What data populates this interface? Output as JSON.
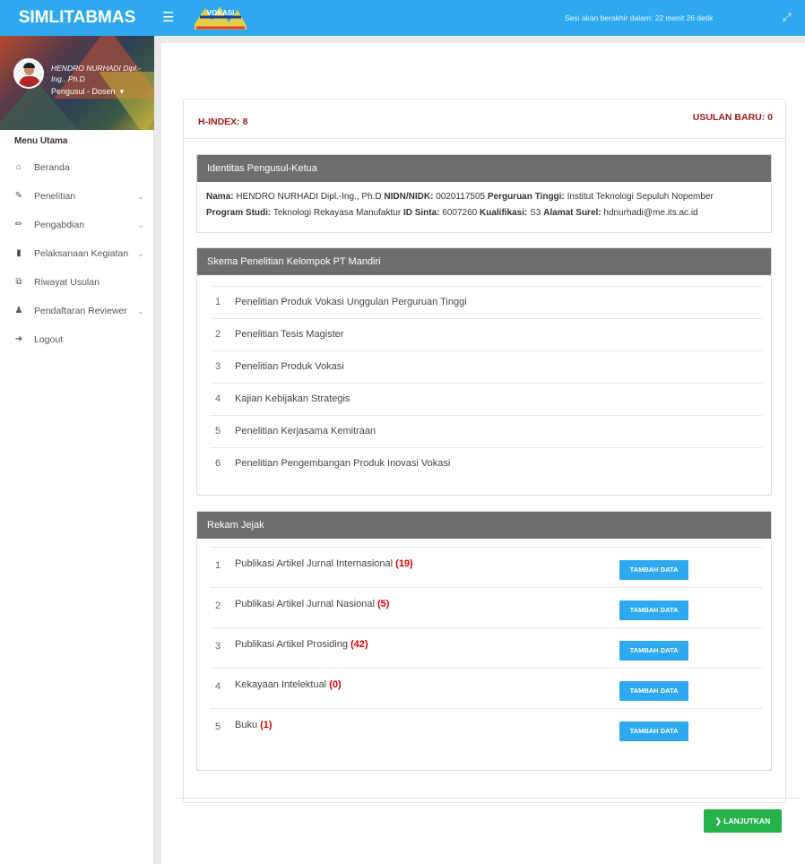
{
  "header": {
    "brand": "SIMLITABMAS",
    "logo_text": "VOKASI",
    "session_text": "Sesi akan berakhir dalam: 22 menit 26 detik"
  },
  "sidebar": {
    "user_name": "HENDRO NURHADI Dipl.-Ing., Ph.D",
    "user_role": "Pengusul - Dosen",
    "menu_title": "Menu Utama",
    "items": [
      {
        "label": "Beranda",
        "icon": "home-icon",
        "has_submenu": false
      },
      {
        "label": "Penelitian",
        "icon": "edit-icon",
        "has_submenu": true
      },
      {
        "label": "Pengabdian",
        "icon": "pencil-icon",
        "has_submenu": true
      },
      {
        "label": "Pelaksanaan Kegiatan",
        "icon": "book-icon",
        "has_submenu": true
      },
      {
        "label": "Riwayat Usulan",
        "icon": "copy-icon",
        "has_submenu": false
      },
      {
        "label": "Pendaftaran Reviewer",
        "icon": "user-icon",
        "has_submenu": true
      },
      {
        "label": "Logout",
        "icon": "logout-icon",
        "has_submenu": false
      }
    ]
  },
  "main": {
    "h_index": "H-INDEX: 8",
    "usulan_baru": "USULAN BARU: 0",
    "identitas": {
      "title": "Identitas Pengusul-Ketua",
      "nama_label": "Nama:",
      "nama": "HENDRO NURHADI Dipl.-Ing., Ph.D",
      "nidn_label": "NIDN/NIDK:",
      "nidn": "0020117505",
      "pt_label": "Perguruan Tinggi:",
      "pt": "Institut Teknologi Sepuluh Nopember",
      "prodi_label": "Program Studi:",
      "prodi": "Teknologi Rekayasa Manufaktur",
      "sinta_label": "ID Sinta:",
      "sinta": "6007260",
      "kualifikasi_label": "Kualifikasi:",
      "kualifikasi": "S3",
      "email_label": "Alamat Surel:",
      "email": "hdnurhadi@me.its.ac.id"
    },
    "skema": {
      "title": "Skema Penelitian Kelompok PT Mandiri",
      "items": [
        {
          "no": "1",
          "label": "Penelitian Produk Vokasi Unggulan Perguruan Tinggi"
        },
        {
          "no": "2",
          "label": "Penelitian Tesis Magister"
        },
        {
          "no": "3",
          "label": "Penelitian Produk Vokasi"
        },
        {
          "no": "4",
          "label": "Kajian Kebijakan Strategis"
        },
        {
          "no": "5",
          "label": "Penelitian Kerjasama Kemitraan"
        },
        {
          "no": "6",
          "label": "Penelitian Pengembangan Produk Inovasi Vokasi"
        }
      ]
    },
    "rekam": {
      "title": "Rekam Jejak",
      "button_label": "TAMBAH DATA",
      "items": [
        {
          "no": "1",
          "label": "Publikasi Artikel Jurnal Internasional",
          "count": "(19)"
        },
        {
          "no": "2",
          "label": "Publikasi Artikel Jurnal Nasional",
          "count": "(5)"
        },
        {
          "no": "3",
          "label": "Publikasi Artikel Prosiding",
          "count": "(42)"
        },
        {
          "no": "4",
          "label": "Kekayaan Intelektual",
          "count": "(0)"
        },
        {
          "no": "5",
          "label": "Buku",
          "count": "(1)"
        }
      ]
    },
    "next_label": "LANJUTKAN"
  }
}
